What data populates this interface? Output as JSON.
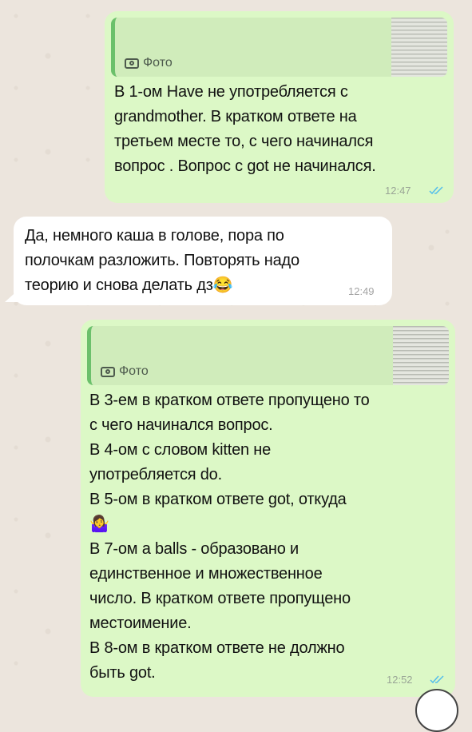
{
  "messages": [
    {
      "quote_label": "Фото",
      "text": "В 1-ом Have не употребляется с\ngrandmother. В кратком ответе на\nтретьем месте то, с чего начинался\nвопрос . Вопрос с got не начинался.",
      "time": "12:47"
    },
    {
      "text": "Да, немного каша в голове, пора по\nполочкам разложить. Повторять надо\nтеорию и снова делать дз😂",
      "time": "12:49"
    },
    {
      "quote_label": "Фото",
      "text": "В 3-ем в кратком ответе пропущено то\nс чего начинался вопрос.\nВ 4-ом с словом kitten не\nупотребляется do.\nВ 5-ом в кратком ответе got, откуда\n🤷‍♀️\nВ 7-ом a balls - образовано и\nединственное и множественное\nчисло. В кратком ответе пропущено\nместоимение.\nВ 8-ом в кратком ответе не должно\nбыть got.",
      "time": "12:52"
    }
  ],
  "colors": {
    "outgoing_bubble": "#dcf8c6",
    "incoming_bubble": "#ffffff",
    "read_ticks": "#53bdeb",
    "background": "#ece5dd"
  },
  "icons": {
    "quote": "camera-icon",
    "status": "double-check-read-icon"
  }
}
